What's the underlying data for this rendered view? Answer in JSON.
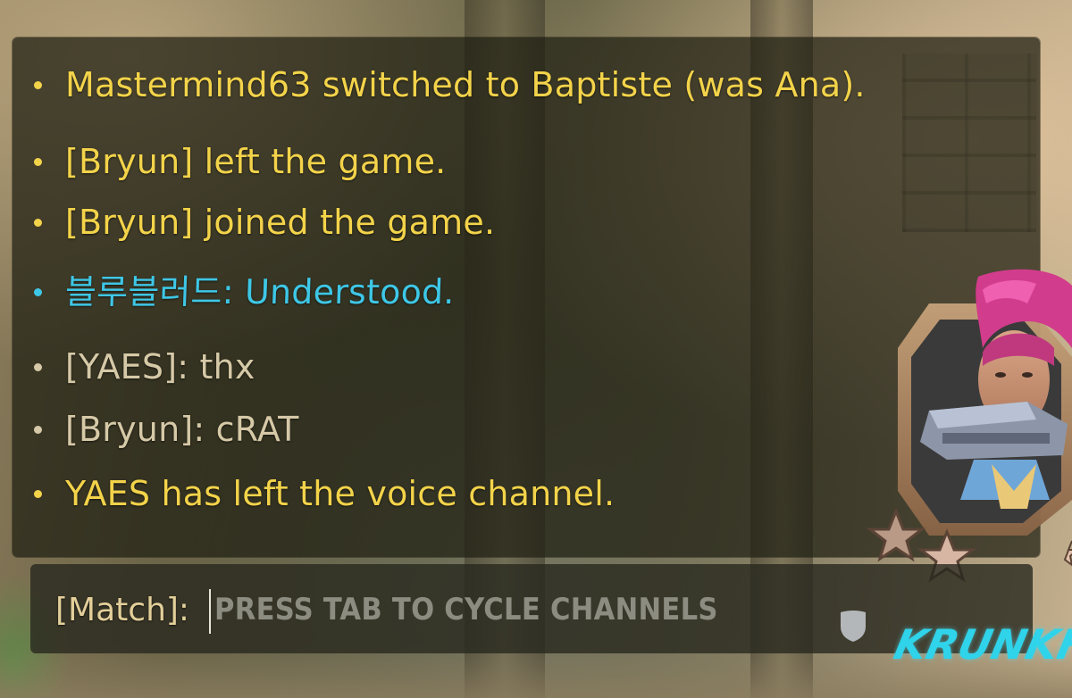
{
  "colors": {
    "system_message": "#f3d34a",
    "team_message": "#d6c9a7",
    "enemy_or_other_message": "#3ec7e6",
    "channel_label": "#e3cf9a",
    "placeholder": "#8d8c80",
    "watermark": "#2fd3ea"
  },
  "chat": {
    "messages": [
      {
        "text": "Mastermind63 switched to Baptiste (was Ana).",
        "color": "#f3d34a"
      },
      {
        "text": "[Bryun] left the game.",
        "color": "#f3d34a"
      },
      {
        "text": "[Bryun] joined the game.",
        "color": "#f3d34a"
      },
      {
        "text": "블루블러드: Understood.",
        "color": "#3ec7e6"
      },
      {
        "text": "[YAES]: thx",
        "color": "#d6c9a7"
      },
      {
        "text": "[Bryun]: cRAT",
        "color": "#d6c9a7"
      },
      {
        "text": "YAES has left the voice channel.",
        "color": "#f3d34a"
      }
    ]
  },
  "input": {
    "channel_label": "[Match]:",
    "placeholder": "PRESS TAB TO CYCLE CHANNELS",
    "value": ""
  },
  "hud": {
    "hero_icon": "zarya-portrait-icon",
    "rank_icon": "rank-stars-icon",
    "emote_icon": "shield-icon",
    "watermark_text": "KRUNKFO"
  }
}
